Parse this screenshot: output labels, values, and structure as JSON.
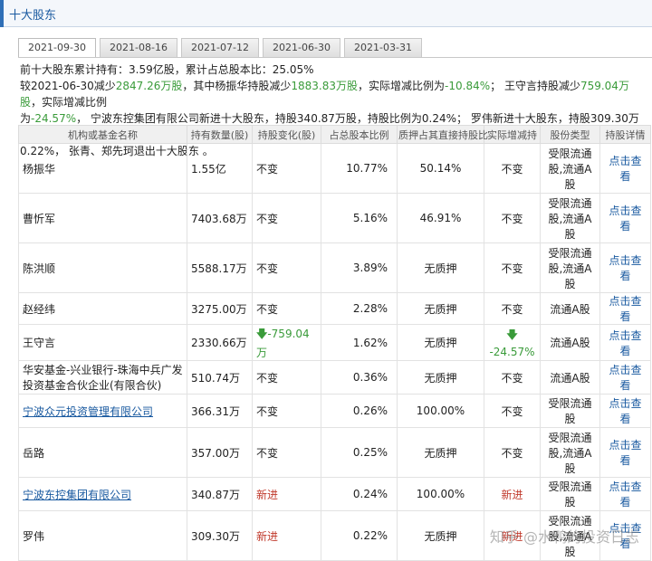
{
  "header": {
    "title": "十大股东"
  },
  "tabs": [
    {
      "label": "2021-09-30",
      "active": true
    },
    {
      "label": "2021-08-16",
      "active": false
    },
    {
      "label": "2021-07-12",
      "active": false
    },
    {
      "label": "2021-06-30",
      "active": false
    },
    {
      "label": "2021-03-31",
      "active": false
    }
  ],
  "summary": {
    "l1a": "前十大股东累计持有：",
    "l1b": "3.59亿股",
    "l1c": "，累计占总股本比：",
    "l1d": "25.05%",
    "l2a": "较2021-06-30减少",
    "l2b": "2847.26万股",
    "l2c": "，其中杨振华持股减少",
    "l2d": "1883.83万股",
    "l2e": "，实际增减比例为",
    "l2f": "-10.84%",
    "l2g": "； 王守言持股减少",
    "l2h": "759.04万股",
    "l2i": "，实际增减比例",
    "l3a": "为",
    "l3b": "-24.57%",
    "l3c": "， 宁波东控集团有限公司新进十大股东，持股340.87万股，持股比例为0.24%； 罗伟新进十大股东，持股309.30万股，持股比例为",
    "l4a": "0.22%， 张青、郑先珂退出十大股东 。"
  },
  "table": {
    "headers": [
      "机构或基金名称",
      "持有数量(股)",
      "持股变化(股)",
      "占总股本比例",
      "质押占其直接持股比",
      "实际增减持",
      "股份类型",
      "持股详情"
    ],
    "rows": [
      {
        "name": "杨振华",
        "qty": "1.55亿",
        "change": "不变",
        "pct": "10.77%",
        "pledge": "50.14%",
        "actual": "不变",
        "type": "受限流通股,流通A股",
        "detail": "点击查看"
      },
      {
        "name": "曹忻军",
        "qty": "7403.68万",
        "change": "不变",
        "pct": "5.16%",
        "pledge": "46.91%",
        "actual": "不变",
        "type": "受限流通股,流通A股",
        "detail": "点击查看"
      },
      {
        "name": "陈洪顺",
        "qty": "5588.17万",
        "change": "不变",
        "pct": "3.89%",
        "pledge": "无质押",
        "actual": "不变",
        "type": "受限流通股,流通A股",
        "detail": "点击查看"
      },
      {
        "name": "赵经纬",
        "qty": "3275.00万",
        "change": "不变",
        "pct": "2.28%",
        "pledge": "无质押",
        "actual": "不变",
        "type": "流通A股",
        "detail": "点击查看"
      },
      {
        "name": "王守言",
        "qty": "2330.66万",
        "change": "-759.04万",
        "pct": "1.62%",
        "pledge": "无质押",
        "actual": "-24.57%",
        "type": "流通A股",
        "detail": "点击查看"
      },
      {
        "name": "华安基金-兴业银行-珠海中兵广发投资基金合伙企业(有限合伙)",
        "qty": "510.74万",
        "change": "不变",
        "pct": "0.36%",
        "pledge": "无质押",
        "actual": "不变",
        "type": "流通A股",
        "detail": "点击查看"
      },
      {
        "name": "宁波众元投资管理有限公司",
        "qty": "366.31万",
        "change": "不变",
        "pct": "0.26%",
        "pledge": "100.00%",
        "actual": "不变",
        "type": "受限流通股",
        "detail": "点击查看"
      },
      {
        "name": "岳路",
        "qty": "357.00万",
        "change": "不变",
        "pct": "0.25%",
        "pledge": "无质押",
        "actual": "不变",
        "type": "受限流通股,流通A股",
        "detail": "点击查看"
      },
      {
        "name": "宁波东控集团有限公司",
        "qty": "340.87万",
        "change": "新进",
        "pct": "0.24%",
        "pledge": "100.00%",
        "actual": "新进",
        "type": "受限流通股",
        "detail": "点击查看"
      },
      {
        "name": "罗伟",
        "qty": "309.30万",
        "change": "新进",
        "pct": "0.22%",
        "pledge": "无质押",
        "actual": "新进",
        "type": "受限流通股,流通A股",
        "detail": "点击查看"
      }
    ]
  },
  "watermark": "知乎 @水鸭的投资日志",
  "colors": {
    "accent": "#1a5aa0",
    "green": "#3a9b3a",
    "red": "#c0392b"
  }
}
